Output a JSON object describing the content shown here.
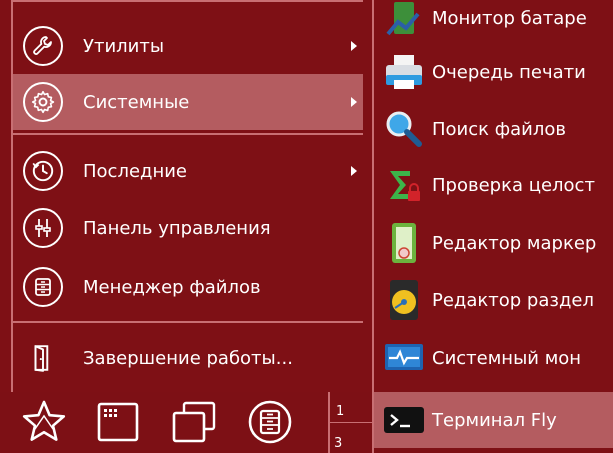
{
  "menu": {
    "items": [
      {
        "label": "Утилиты",
        "icon": "wrench-icon",
        "has_submenu": true
      },
      {
        "label": "Системные",
        "icon": "gear-icon",
        "has_submenu": true,
        "active": true
      },
      {
        "label": "Последние",
        "icon": "clock-icon",
        "has_submenu": true
      },
      {
        "label": "Панель управления",
        "icon": "sliders-icon",
        "has_submenu": false
      },
      {
        "label": "Менеджер файлов",
        "icon": "file-cabinet-icon",
        "has_submenu": false
      },
      {
        "label": "Завершение работы...",
        "icon": "door-icon",
        "has_submenu": false
      }
    ]
  },
  "submenu": {
    "items": [
      {
        "label": "Монитор батаре",
        "icon": "battery-monitor-icon"
      },
      {
        "label": "Очередь печати",
        "icon": "printer-icon"
      },
      {
        "label": "Поиск файлов",
        "icon": "magnifier-icon"
      },
      {
        "label": "Проверка целост",
        "icon": "integrity-check-icon"
      },
      {
        "label": "Редактор маркер",
        "icon": "marker-editor-icon"
      },
      {
        "label": "Редактор раздел",
        "icon": "partition-editor-icon"
      },
      {
        "label": "Системный мон",
        "icon": "system-monitor-icon"
      },
      {
        "label": "Терминал Fly",
        "icon": "terminal-icon",
        "active": true
      }
    ]
  },
  "taskbar": {
    "buttons": [
      "start-star-icon",
      "app-grid-icon",
      "windows-icon",
      "file-manager-icon"
    ],
    "pager": {
      "desk1": "1",
      "desk3": "3"
    }
  },
  "colors": {
    "background": "#7e1015",
    "highlight": "#b45c60",
    "border": "#c86f73"
  }
}
